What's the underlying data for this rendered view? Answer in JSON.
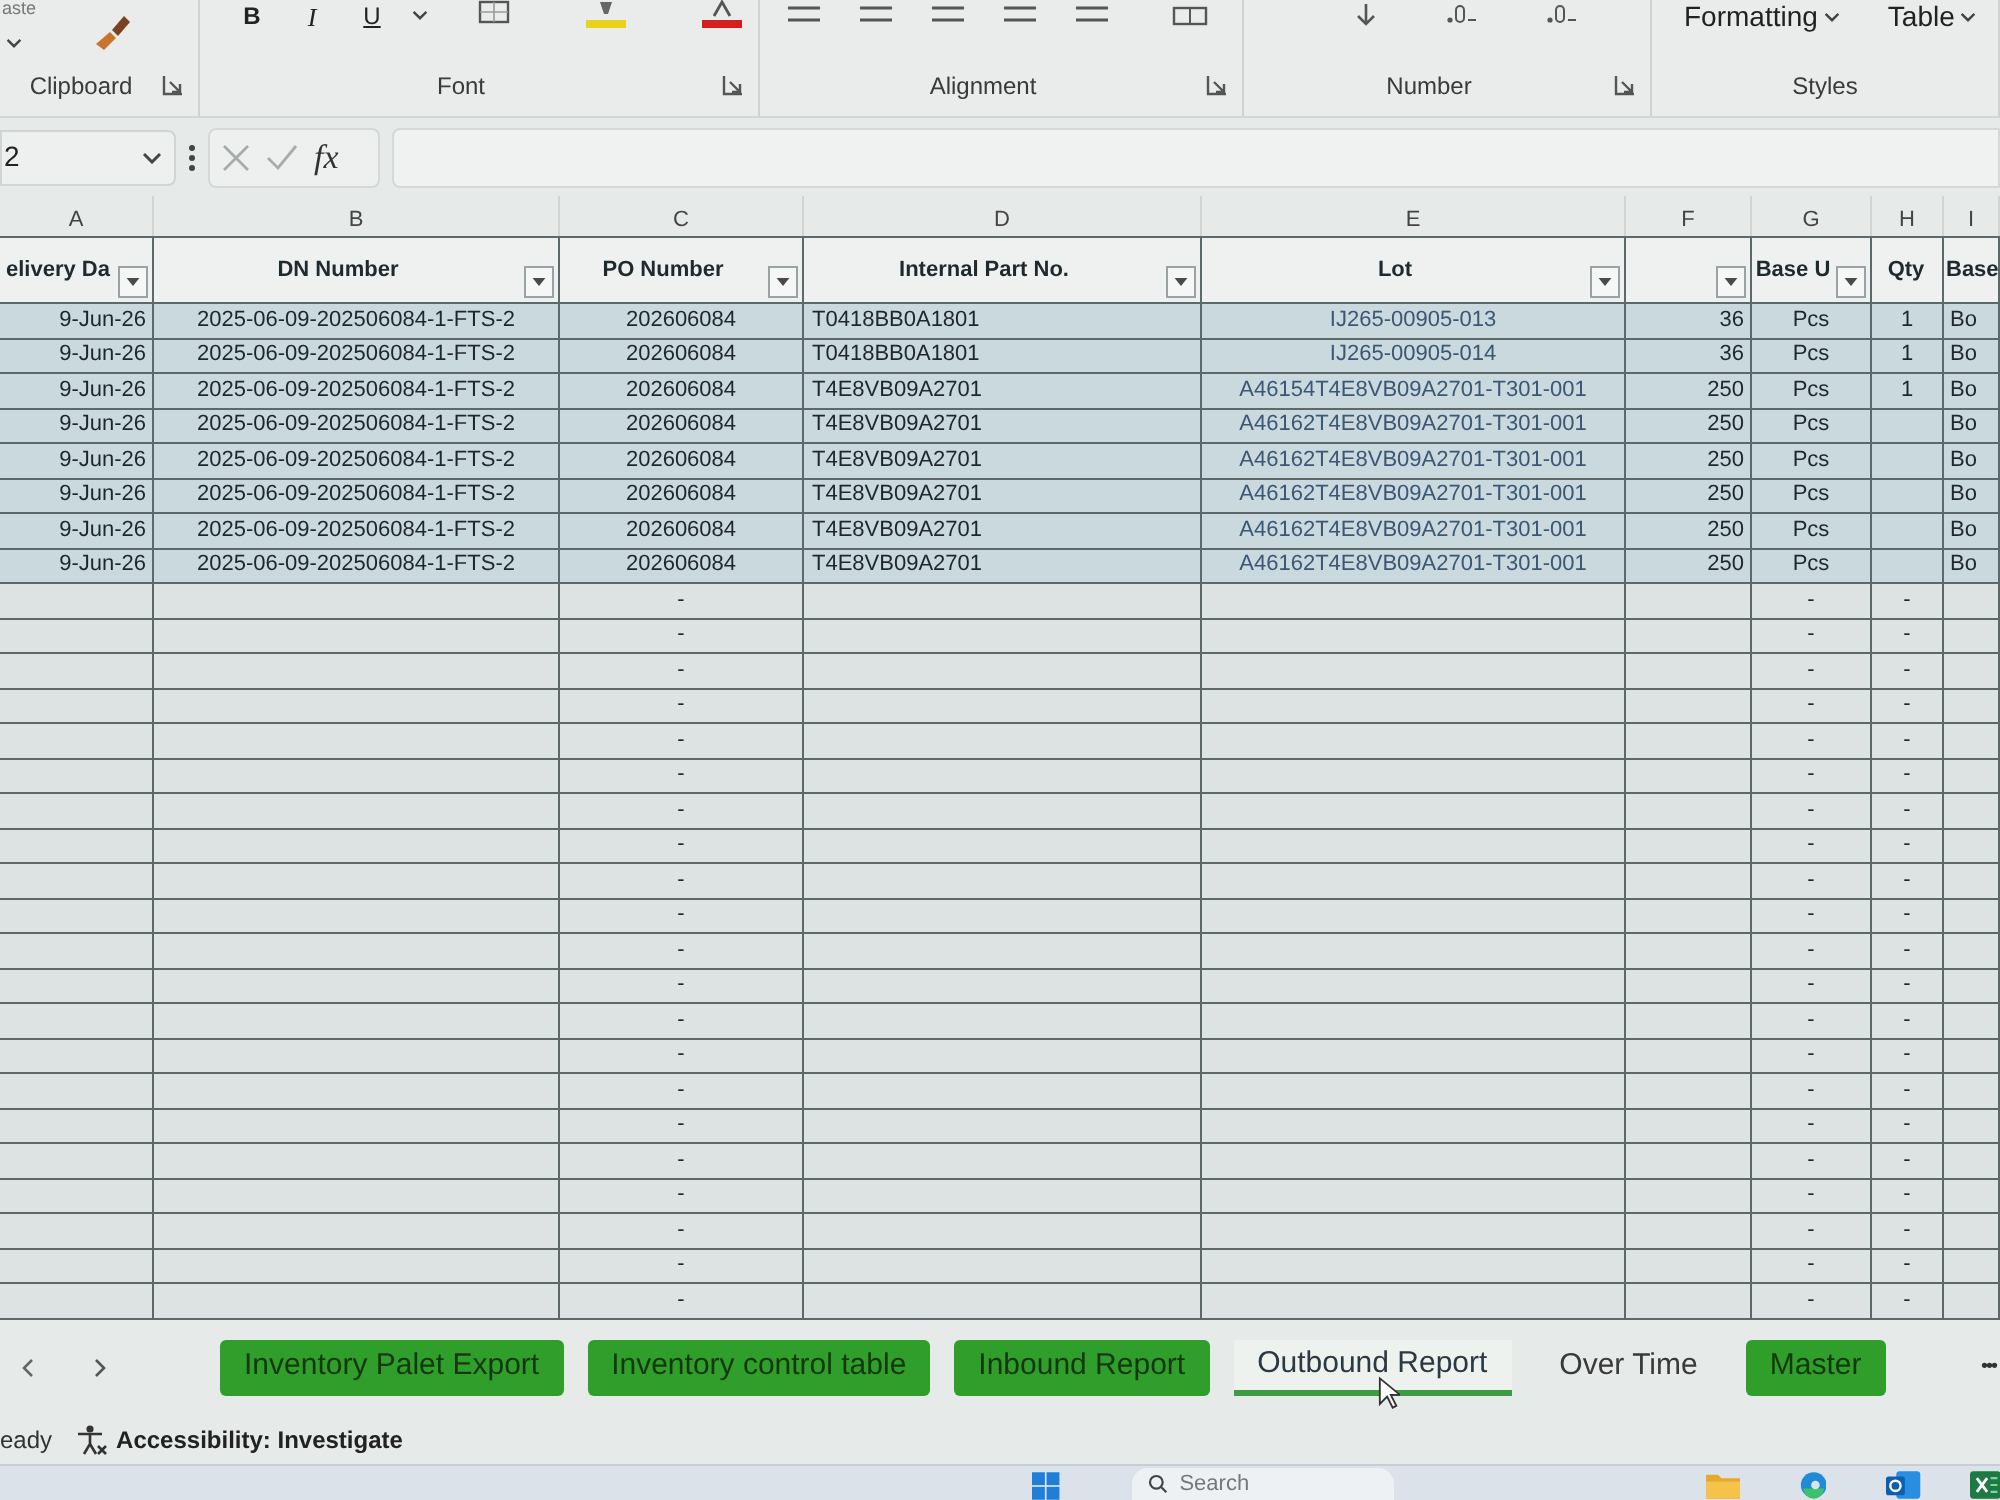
{
  "ribbon": {
    "groups": [
      {
        "kind": "clipboard",
        "label": "Clipboard",
        "launcher": true,
        "paste_label": "aste"
      },
      {
        "kind": "font",
        "label": "Font",
        "launcher": true,
        "buttons": [
          {
            "label": "B",
            "kind": "bold"
          },
          {
            "label": "I",
            "kind": "italic"
          },
          {
            "label": "U",
            "kind": "underline"
          }
        ]
      },
      {
        "kind": "alignment",
        "label": "Alignment",
        "launcher": true
      },
      {
        "kind": "number",
        "label": "Number",
        "launcher": true
      },
      {
        "kind": "styles",
        "label": "Styles",
        "launcher": false,
        "buttons": [
          {
            "label": "Formatting",
            "kind": "dropdown"
          },
          {
            "label": "Table",
            "kind": "dropdown"
          }
        ]
      }
    ]
  },
  "formula_bar": {
    "name_box": "2",
    "function_label": "fx"
  },
  "sheet": {
    "column_letters": [
      "A",
      "B",
      "C",
      "D",
      "E",
      "F",
      "G",
      "H",
      "I"
    ],
    "columns": [
      {
        "label": "elivery Da",
        "filter": true
      },
      {
        "label": "DN Number",
        "filter": true
      },
      {
        "label": "PO Number",
        "filter": true
      },
      {
        "label": "Internal Part No.",
        "filter": true
      },
      {
        "label": "Lot",
        "filter": true
      },
      {
        "filter": true
      },
      {
        "label": "Base U",
        "filter": true
      },
      {
        "label": "Qty",
        "filter": false
      },
      {
        "label": "Base",
        "filter": false
      }
    ],
    "rows": [
      {
        "column_a": "9-Jun-26",
        "dn_number": "2025-06-09-202506084-1-FTS-2",
        "po_number": "202606084",
        "internal_part_no": "T0418BB0A1801",
        "lot": "IJ265-00905-013",
        "column_f": "36",
        "column_g": "Pcs",
        "qty": "1",
        "column_i": "Bo"
      },
      {
        "column_a": "9-Jun-26",
        "dn_number": "2025-06-09-202506084-1-FTS-2",
        "po_number": "202606084",
        "internal_part_no": "T0418BB0A1801",
        "lot": "IJ265-00905-014",
        "column_f": "36",
        "column_g": "Pcs",
        "qty": "1",
        "column_i": "Bo"
      },
      {
        "column_a": "9-Jun-26",
        "dn_number": "2025-06-09-202506084-1-FTS-2",
        "po_number": "202606084",
        "internal_part_no": "T4E8VB09A2701",
        "lot": "A46154T4E8VB09A2701-T301-001",
        "column_f": "250",
        "column_g": "Pcs",
        "qty": "1",
        "column_i": "Bo"
      },
      {
        "column_a": "9-Jun-26",
        "dn_number": "2025-06-09-202506084-1-FTS-2",
        "po_number": "202606084",
        "internal_part_no": "T4E8VB09A2701",
        "lot": "A46162T4E8VB09A2701-T301-001",
        "column_f": "250",
        "column_g": "Pcs",
        "column_i": "Bo"
      },
      {
        "column_a": "9-Jun-26",
        "dn_number": "2025-06-09-202506084-1-FTS-2",
        "po_number": "202606084",
        "internal_part_no": "T4E8VB09A2701",
        "lot": "A46162T4E8VB09A2701-T301-001",
        "column_f": "250",
        "column_g": "Pcs",
        "column_i": "Bo"
      },
      {
        "column_a": "9-Jun-26",
        "dn_number": "2025-06-09-202506084-1-FTS-2",
        "po_number": "202606084",
        "internal_part_no": "T4E8VB09A2701",
        "lot": "A46162T4E8VB09A2701-T301-001",
        "column_f": "250",
        "column_g": "Pcs",
        "column_i": "Bo"
      },
      {
        "column_a": "9-Jun-26",
        "dn_number": "2025-06-09-202506084-1-FTS-2",
        "po_number": "202606084",
        "internal_part_no": "T4E8VB09A2701",
        "lot": "A46162T4E8VB09A2701-T301-001",
        "column_f": "250",
        "column_g": "Pcs",
        "column_i": "Bo"
      },
      {
        "column_a": "9-Jun-26",
        "dn_number": "2025-06-09-202506084-1-FTS-2",
        "po_number": "202606084",
        "internal_part_no": "T4E8VB09A2701",
        "lot": "A46162T4E8VB09A2701-T301-001",
        "column_f": "250",
        "column_g": "Pcs",
        "column_i": "Bo"
      },
      {
        "po_number": "-",
        "column_g": "-",
        "qty": "-"
      },
      {
        "po_number": "-",
        "column_g": "-",
        "qty": "-"
      },
      {
        "po_number": "-",
        "column_g": "-",
        "qty": "-"
      },
      {
        "po_number": "-",
        "column_g": "-",
        "qty": "-"
      },
      {
        "po_number": "-",
        "column_g": "-",
        "qty": "-"
      },
      {
        "po_number": "-",
        "column_g": "-",
        "qty": "-"
      },
      {
        "po_number": "-",
        "column_g": "-",
        "qty": "-"
      },
      {
        "po_number": "-",
        "column_g": "-",
        "qty": "-"
      },
      {
        "po_number": "-",
        "column_g": "-",
        "qty": "-"
      },
      {
        "po_number": "-",
        "column_g": "-",
        "qty": "-"
      },
      {
        "po_number": "-",
        "column_g": "-",
        "qty": "-"
      },
      {
        "po_number": "-",
        "column_g": "-",
        "qty": "-"
      },
      {
        "po_number": "-",
        "column_g": "-",
        "qty": "-"
      },
      {
        "po_number": "-",
        "column_g": "-",
        "qty": "-"
      },
      {
        "po_number": "-",
        "column_g": "-",
        "qty": "-"
      },
      {
        "po_number": "-",
        "column_g": "-",
        "qty": "-"
      },
      {
        "po_number": "-",
        "column_g": "-",
        "qty": "-"
      },
      {
        "po_number": "-",
        "column_g": "-",
        "qty": "-"
      },
      {
        "po_number": "-",
        "column_g": "-",
        "qty": "-"
      },
      {
        "po_number": "-",
        "column_g": "-",
        "qty": "-"
      },
      {
        "po_number": "-",
        "column_g": "-",
        "qty": "-"
      }
    ]
  },
  "sheet_tabs": [
    {
      "label": "Inventory Palet Export",
      "selected": false,
      "color": "#2f9e2b"
    },
    {
      "label": "Inventory control table",
      "selected": false,
      "color": "#2f9e2b"
    },
    {
      "label": "Inbound Report",
      "selected": false,
      "color": "#2f9e2b"
    },
    {
      "label": "Outbound Report",
      "selected": true
    },
    {
      "label": "Over Time",
      "selected": false
    },
    {
      "label": "Master",
      "selected": false,
      "color": "#2f9e2b"
    }
  ],
  "more_tabs": "•••",
  "status_bar": {
    "mode": "eady",
    "accessibility": "Accessibility: Investigate"
  },
  "taskbar": {
    "search_placeholder": "Search"
  }
}
